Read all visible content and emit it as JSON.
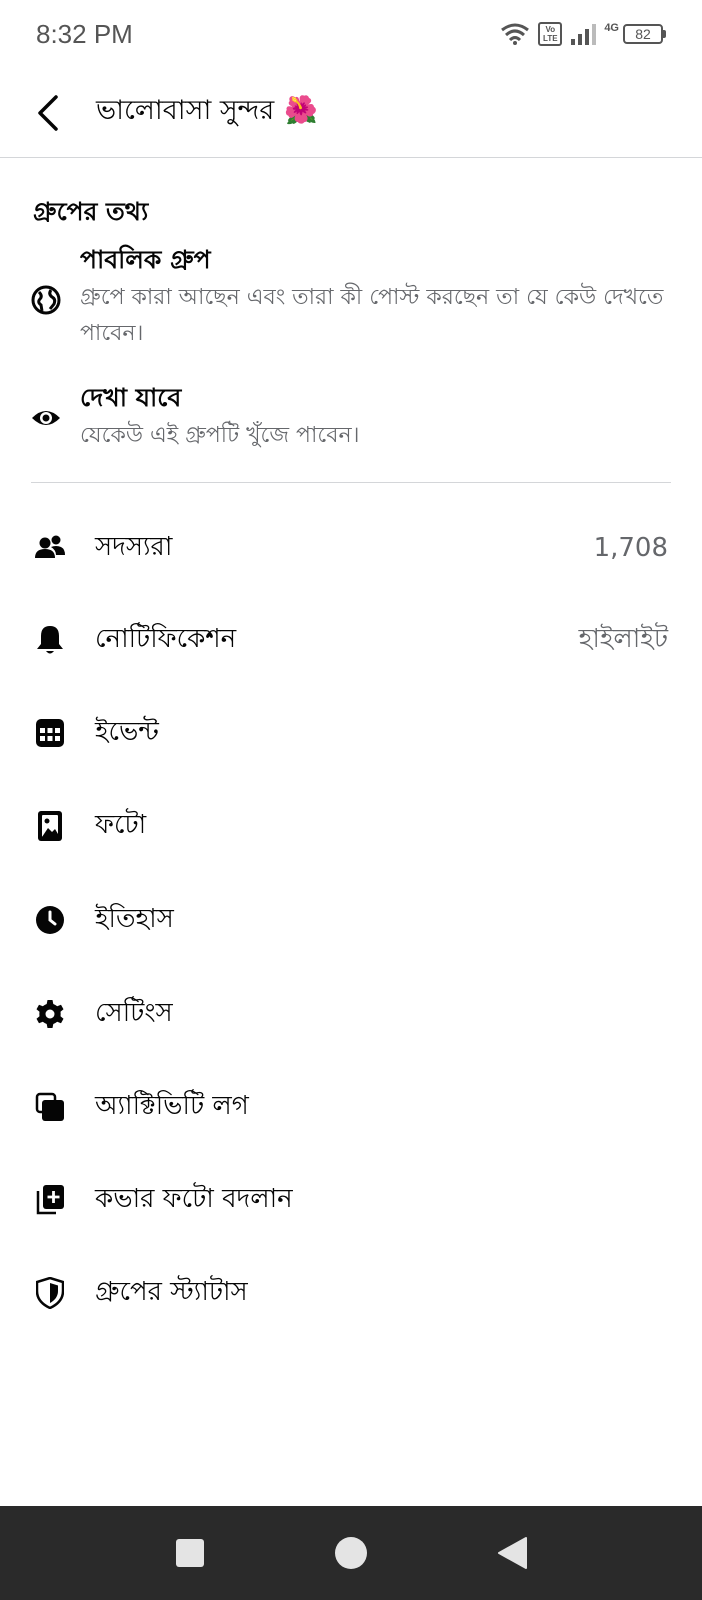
{
  "status_bar": {
    "time": "8:32 PM",
    "volte_top": "Vo",
    "volte_bottom": "LTE",
    "network": "4G",
    "battery": "82"
  },
  "header": {
    "title": "ভালোবাসা সুন্দর",
    "emoji": "🌺"
  },
  "group_info": {
    "section_title": "গ্রুপের তথ্য",
    "privacy": {
      "title": "পাবলিক গ্রুপ",
      "description": "গ্রুপে কারা আছেন এবং তারা কী পোস্ট করছেন তা যে কেউ দেখতে পাবেন।"
    },
    "visibility": {
      "title": "দেখা যাবে",
      "description": "যেকেউ এই গ্রুপটি খুঁজে পাবেন।"
    }
  },
  "menu": [
    {
      "label": "সদস্যরা",
      "value": "1,708",
      "icon": "members-icon"
    },
    {
      "label": "নোটিফিকেশন",
      "value": "হাইলাইট",
      "icon": "bell-icon"
    },
    {
      "label": "ইভেন্ট",
      "value": "",
      "icon": "calendar-icon"
    },
    {
      "label": "ফটো",
      "value": "",
      "icon": "photo-icon"
    },
    {
      "label": "ইতিহাস",
      "value": "",
      "icon": "clock-icon"
    },
    {
      "label": "সেটিংস",
      "value": "",
      "icon": "gear-icon"
    },
    {
      "label": "অ্যাক্টিভিটি লগ",
      "value": "",
      "icon": "activity-log-icon"
    },
    {
      "label": "কভার ফটো বদলান",
      "value": "",
      "icon": "add-photo-icon"
    },
    {
      "label": "গ্রুপের স্ট্যাটাস",
      "value": "",
      "icon": "shield-icon"
    }
  ],
  "colors": {
    "primary_text": "#050505",
    "secondary_text": "#65676b",
    "divider": "#d4d6d9",
    "nav_bar": "#2a2a2a"
  }
}
